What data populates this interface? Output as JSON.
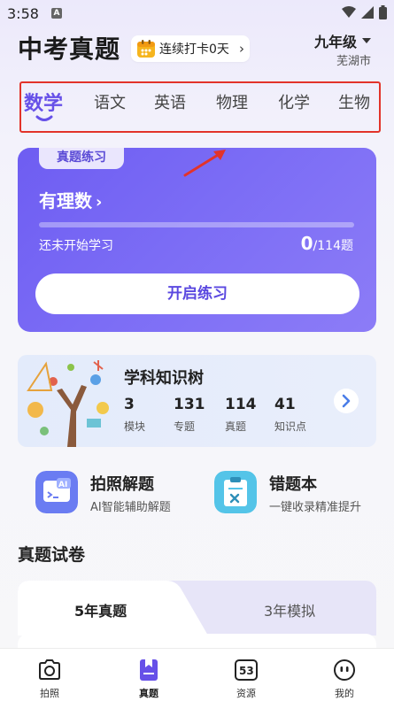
{
  "status_bar": {
    "time": "3:58",
    "app_icon": "A"
  },
  "header": {
    "title": "中考真题",
    "checkin_label": "连续打卡0天",
    "grade": "九年级",
    "city": "芜湖市"
  },
  "subjects": [
    "数学",
    "语文",
    "英语",
    "物理",
    "化学",
    "生物"
  ],
  "active_subject": "数学",
  "practice": {
    "badge": "真题练习",
    "chapter": "有理数",
    "status": "还未开始学习",
    "done": "0",
    "total": "/114题",
    "progress": 0,
    "start_label": "开启练习"
  },
  "knowledge_tree": {
    "title": "学科知识树",
    "stats": [
      {
        "value": "3",
        "label": "模块"
      },
      {
        "value": "131",
        "label": "专题"
      },
      {
        "value": "114",
        "label": "真题"
      },
      {
        "value": "41",
        "label": "知识点"
      }
    ]
  },
  "tools": [
    {
      "title": "拍照解题",
      "subtitle": "AI智能辅助解题",
      "icon": "ai-camera-icon"
    },
    {
      "title": "错题本",
      "subtitle": "一键收录精准提升",
      "icon": "mistake-book-icon"
    }
  ],
  "papers": {
    "section_title": "真题试卷",
    "tabs": [
      "5年真题",
      "3年模拟"
    ]
  },
  "bottom_nav": [
    {
      "label": "拍照",
      "icon": "camera-icon"
    },
    {
      "label": "真题",
      "icon": "book-icon"
    },
    {
      "label": "资源",
      "icon": "resource-53-icon"
    },
    {
      "label": "我的",
      "icon": "profile-face-icon"
    }
  ],
  "colors": {
    "accent": "#6650e8",
    "annotation": "#e2332a",
    "tool_blue": "#6a7cf2",
    "tool_cyan": "#54c4e8"
  }
}
